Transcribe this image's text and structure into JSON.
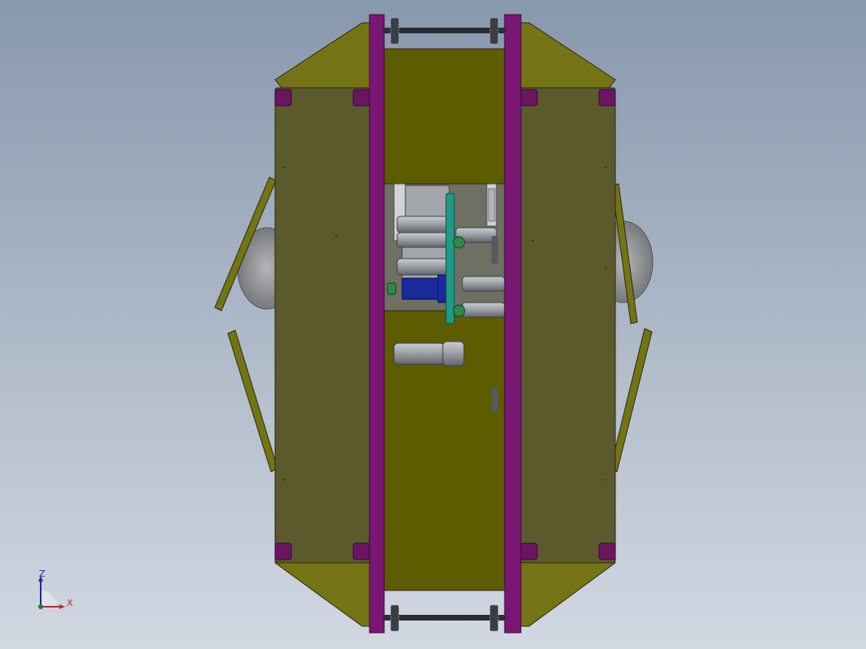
{
  "viewport": {
    "background_top": "#8898ad",
    "background_bottom": "#d2d8e2"
  },
  "model": {
    "colors": {
      "panel_dark": "#5b5a2c",
      "panel_bright": "#5e5c00",
      "wing": "#757414",
      "rail": "#7a1775",
      "joint": "#6a1560",
      "wheel": "#8c8c8c",
      "shaft": "#2a2d33",
      "metal": "#9aa0a6",
      "teal_gear": "#1e9a88",
      "green_hub": "#2e8a4a",
      "blue_motor": "#1a2a9a",
      "outline": "#2a2a10"
    }
  },
  "triad": {
    "z_label": "Z",
    "x_label": "X",
    "z_color": "#1a2a9a",
    "x_color": "#c0282a",
    "y_color": "#1f7a3a"
  }
}
